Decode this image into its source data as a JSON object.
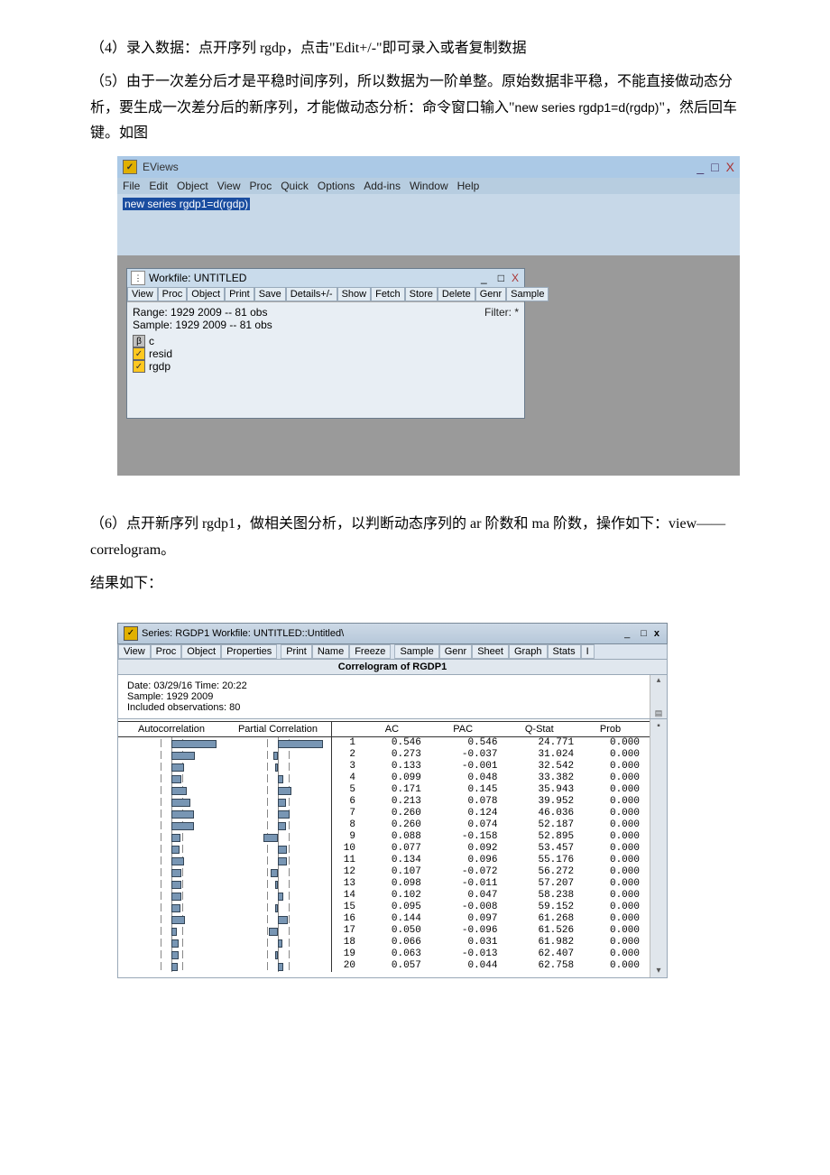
{
  "para4": "（4）录入数据：点开序列 rgdp，点击\"Edit+/-\"即可录入或者复制数据",
  "para5a": "（5）由于一次差分后才是平稳时间序列，所以数据为一阶单整。原始数据非平稳，不能直接做动态分析，要生成一次差分后的新序列，才能做动态分析：命令窗口输入\"",
  "para5cmd": "new series rgdp1=d(rgdp)",
  "para5b": "\"，然后回车键。如图",
  "eviews": {
    "title": "EViews",
    "menu": [
      "File",
      "Edit",
      "Object",
      "View",
      "Proc",
      "Quick",
      "Options",
      "Add-ins",
      "Window",
      "Help"
    ],
    "command": "new series rgdp1=d(rgdp)",
    "workfile": {
      "title": "Workfile: UNTITLED",
      "toolbar1": [
        "View",
        "Proc",
        "Object"
      ],
      "toolbar2": [
        "Print",
        "Save",
        "Details+/-"
      ],
      "toolbar3": [
        "Show",
        "Fetch",
        "Store",
        "Delete",
        "Genr",
        "Sample"
      ],
      "range": "Range: 1929 2009  --  81 obs",
      "sample": "Sample: 1929 2009  --  81 obs",
      "filter": "Filter: *",
      "vars": [
        "c",
        "resid",
        "rgdp"
      ]
    }
  },
  "para6a": "（6）点开新序列 rgdp1，做相关图分析，以判断动态序列的 ar 阶数和 ma 阶数，操作如下：view——correlogram。",
  "para6b": "结果如下：",
  "series": {
    "title": "Series: RGDP1   Workfile: UNTITLED::Untitled\\",
    "toolbar1": [
      "View",
      "Proc",
      "Object",
      "Properties"
    ],
    "toolbar2": [
      "Print",
      "Name",
      "Freeze"
    ],
    "toolbar3": [
      "Sample",
      "Genr",
      "Sheet",
      "Graph",
      "Stats",
      "I"
    ],
    "header": "Correlogram of RGDP1",
    "meta1": "Date: 03/29/16   Time: 20:22",
    "meta2": "Sample: 1929 2009",
    "meta3": "Included observations: 80",
    "cols": [
      "Autocorrelation",
      "Partial Correlation",
      "",
      "AC",
      "PAC",
      "Q-Stat",
      "Prob"
    ]
  },
  "chart_data": {
    "type": "table",
    "title": "Correlogram of RGDP1",
    "columns": [
      "lag",
      "AC",
      "PAC",
      "Q-Stat",
      "Prob"
    ],
    "rows": [
      {
        "lag": 1,
        "ac": 0.546,
        "pac": 0.546,
        "q": 24.771,
        "p": 0.0
      },
      {
        "lag": 2,
        "ac": 0.273,
        "pac": -0.037,
        "q": 31.024,
        "p": 0.0
      },
      {
        "lag": 3,
        "ac": 0.133,
        "pac": -0.001,
        "q": 32.542,
        "p": 0.0
      },
      {
        "lag": 4,
        "ac": 0.099,
        "pac": 0.048,
        "q": 33.382,
        "p": 0.0
      },
      {
        "lag": 5,
        "ac": 0.171,
        "pac": 0.145,
        "q": 35.943,
        "p": 0.0
      },
      {
        "lag": 6,
        "ac": 0.213,
        "pac": 0.078,
        "q": 39.952,
        "p": 0.0
      },
      {
        "lag": 7,
        "ac": 0.26,
        "pac": 0.124,
        "q": 46.036,
        "p": 0.0
      },
      {
        "lag": 8,
        "ac": 0.26,
        "pac": 0.074,
        "q": 52.187,
        "p": 0.0
      },
      {
        "lag": 9,
        "ac": 0.088,
        "pac": -0.158,
        "q": 52.895,
        "p": 0.0
      },
      {
        "lag": 10,
        "ac": 0.077,
        "pac": 0.092,
        "q": 53.457,
        "p": 0.0
      },
      {
        "lag": 11,
        "ac": 0.134,
        "pac": 0.096,
        "q": 55.176,
        "p": 0.0
      },
      {
        "lag": 12,
        "ac": 0.107,
        "pac": -0.072,
        "q": 56.272,
        "p": 0.0
      },
      {
        "lag": 13,
        "ac": 0.098,
        "pac": -0.011,
        "q": 57.207,
        "p": 0.0
      },
      {
        "lag": 14,
        "ac": 0.102,
        "pac": 0.047,
        "q": 58.238,
        "p": 0.0
      },
      {
        "lag": 15,
        "ac": 0.095,
        "pac": -0.008,
        "q": 59.152,
        "p": 0.0
      },
      {
        "lag": 16,
        "ac": 0.144,
        "pac": 0.097,
        "q": 61.268,
        "p": 0.0
      },
      {
        "lag": 17,
        "ac": 0.05,
        "pac": -0.096,
        "q": 61.526,
        "p": 0.0
      },
      {
        "lag": 18,
        "ac": 0.066,
        "pac": 0.031,
        "q": 61.982,
        "p": 0.0
      },
      {
        "lag": 19,
        "ac": 0.063,
        "pac": -0.013,
        "q": 62.407,
        "p": 0.0
      },
      {
        "lag": 20,
        "ac": 0.057,
        "pac": 0.044,
        "q": 62.758,
        "p": 0.0
      }
    ]
  }
}
